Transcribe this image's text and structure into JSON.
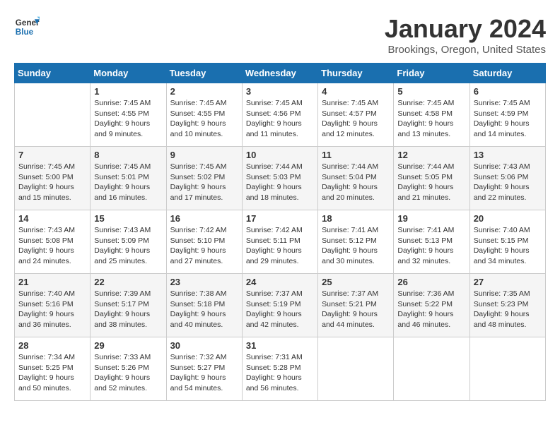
{
  "header": {
    "logo_line1": "General",
    "logo_line2": "Blue",
    "month_title": "January 2024",
    "location": "Brookings, Oregon, United States"
  },
  "days_of_week": [
    "Sunday",
    "Monday",
    "Tuesday",
    "Wednesday",
    "Thursday",
    "Friday",
    "Saturday"
  ],
  "weeks": [
    [
      {
        "day": "",
        "sunrise": "",
        "sunset": "",
        "daylight": "",
        "empty": true
      },
      {
        "day": "1",
        "sunrise": "Sunrise: 7:45 AM",
        "sunset": "Sunset: 4:55 PM",
        "daylight": "Daylight: 9 hours and 9 minutes."
      },
      {
        "day": "2",
        "sunrise": "Sunrise: 7:45 AM",
        "sunset": "Sunset: 4:55 PM",
        "daylight": "Daylight: 9 hours and 10 minutes."
      },
      {
        "day": "3",
        "sunrise": "Sunrise: 7:45 AM",
        "sunset": "Sunset: 4:56 PM",
        "daylight": "Daylight: 9 hours and 11 minutes."
      },
      {
        "day": "4",
        "sunrise": "Sunrise: 7:45 AM",
        "sunset": "Sunset: 4:57 PM",
        "daylight": "Daylight: 9 hours and 12 minutes."
      },
      {
        "day": "5",
        "sunrise": "Sunrise: 7:45 AM",
        "sunset": "Sunset: 4:58 PM",
        "daylight": "Daylight: 9 hours and 13 minutes."
      },
      {
        "day": "6",
        "sunrise": "Sunrise: 7:45 AM",
        "sunset": "Sunset: 4:59 PM",
        "daylight": "Daylight: 9 hours and 14 minutes."
      }
    ],
    [
      {
        "day": "7",
        "sunrise": "Sunrise: 7:45 AM",
        "sunset": "Sunset: 5:00 PM",
        "daylight": "Daylight: 9 hours and 15 minutes."
      },
      {
        "day": "8",
        "sunrise": "Sunrise: 7:45 AM",
        "sunset": "Sunset: 5:01 PM",
        "daylight": "Daylight: 9 hours and 16 minutes."
      },
      {
        "day": "9",
        "sunrise": "Sunrise: 7:45 AM",
        "sunset": "Sunset: 5:02 PM",
        "daylight": "Daylight: 9 hours and 17 minutes."
      },
      {
        "day": "10",
        "sunrise": "Sunrise: 7:44 AM",
        "sunset": "Sunset: 5:03 PM",
        "daylight": "Daylight: 9 hours and 18 minutes."
      },
      {
        "day": "11",
        "sunrise": "Sunrise: 7:44 AM",
        "sunset": "Sunset: 5:04 PM",
        "daylight": "Daylight: 9 hours and 20 minutes."
      },
      {
        "day": "12",
        "sunrise": "Sunrise: 7:44 AM",
        "sunset": "Sunset: 5:05 PM",
        "daylight": "Daylight: 9 hours and 21 minutes."
      },
      {
        "day": "13",
        "sunrise": "Sunrise: 7:43 AM",
        "sunset": "Sunset: 5:06 PM",
        "daylight": "Daylight: 9 hours and 22 minutes."
      }
    ],
    [
      {
        "day": "14",
        "sunrise": "Sunrise: 7:43 AM",
        "sunset": "Sunset: 5:08 PM",
        "daylight": "Daylight: 9 hours and 24 minutes."
      },
      {
        "day": "15",
        "sunrise": "Sunrise: 7:43 AM",
        "sunset": "Sunset: 5:09 PM",
        "daylight": "Daylight: 9 hours and 25 minutes."
      },
      {
        "day": "16",
        "sunrise": "Sunrise: 7:42 AM",
        "sunset": "Sunset: 5:10 PM",
        "daylight": "Daylight: 9 hours and 27 minutes."
      },
      {
        "day": "17",
        "sunrise": "Sunrise: 7:42 AM",
        "sunset": "Sunset: 5:11 PM",
        "daylight": "Daylight: 9 hours and 29 minutes."
      },
      {
        "day": "18",
        "sunrise": "Sunrise: 7:41 AM",
        "sunset": "Sunset: 5:12 PM",
        "daylight": "Daylight: 9 hours and 30 minutes."
      },
      {
        "day": "19",
        "sunrise": "Sunrise: 7:41 AM",
        "sunset": "Sunset: 5:13 PM",
        "daylight": "Daylight: 9 hours and 32 minutes."
      },
      {
        "day": "20",
        "sunrise": "Sunrise: 7:40 AM",
        "sunset": "Sunset: 5:15 PM",
        "daylight": "Daylight: 9 hours and 34 minutes."
      }
    ],
    [
      {
        "day": "21",
        "sunrise": "Sunrise: 7:40 AM",
        "sunset": "Sunset: 5:16 PM",
        "daylight": "Daylight: 9 hours and 36 minutes."
      },
      {
        "day": "22",
        "sunrise": "Sunrise: 7:39 AM",
        "sunset": "Sunset: 5:17 PM",
        "daylight": "Daylight: 9 hours and 38 minutes."
      },
      {
        "day": "23",
        "sunrise": "Sunrise: 7:38 AM",
        "sunset": "Sunset: 5:18 PM",
        "daylight": "Daylight: 9 hours and 40 minutes."
      },
      {
        "day": "24",
        "sunrise": "Sunrise: 7:37 AM",
        "sunset": "Sunset: 5:19 PM",
        "daylight": "Daylight: 9 hours and 42 minutes."
      },
      {
        "day": "25",
        "sunrise": "Sunrise: 7:37 AM",
        "sunset": "Sunset: 5:21 PM",
        "daylight": "Daylight: 9 hours and 44 minutes."
      },
      {
        "day": "26",
        "sunrise": "Sunrise: 7:36 AM",
        "sunset": "Sunset: 5:22 PM",
        "daylight": "Daylight: 9 hours and 46 minutes."
      },
      {
        "day": "27",
        "sunrise": "Sunrise: 7:35 AM",
        "sunset": "Sunset: 5:23 PM",
        "daylight": "Daylight: 9 hours and 48 minutes."
      }
    ],
    [
      {
        "day": "28",
        "sunrise": "Sunrise: 7:34 AM",
        "sunset": "Sunset: 5:25 PM",
        "daylight": "Daylight: 9 hours and 50 minutes."
      },
      {
        "day": "29",
        "sunrise": "Sunrise: 7:33 AM",
        "sunset": "Sunset: 5:26 PM",
        "daylight": "Daylight: 9 hours and 52 minutes."
      },
      {
        "day": "30",
        "sunrise": "Sunrise: 7:32 AM",
        "sunset": "Sunset: 5:27 PM",
        "daylight": "Daylight: 9 hours and 54 minutes."
      },
      {
        "day": "31",
        "sunrise": "Sunrise: 7:31 AM",
        "sunset": "Sunset: 5:28 PM",
        "daylight": "Daylight: 9 hours and 56 minutes."
      },
      {
        "day": "",
        "sunrise": "",
        "sunset": "",
        "daylight": "",
        "empty": true
      },
      {
        "day": "",
        "sunrise": "",
        "sunset": "",
        "daylight": "",
        "empty": true
      },
      {
        "day": "",
        "sunrise": "",
        "sunset": "",
        "daylight": "",
        "empty": true
      }
    ]
  ]
}
